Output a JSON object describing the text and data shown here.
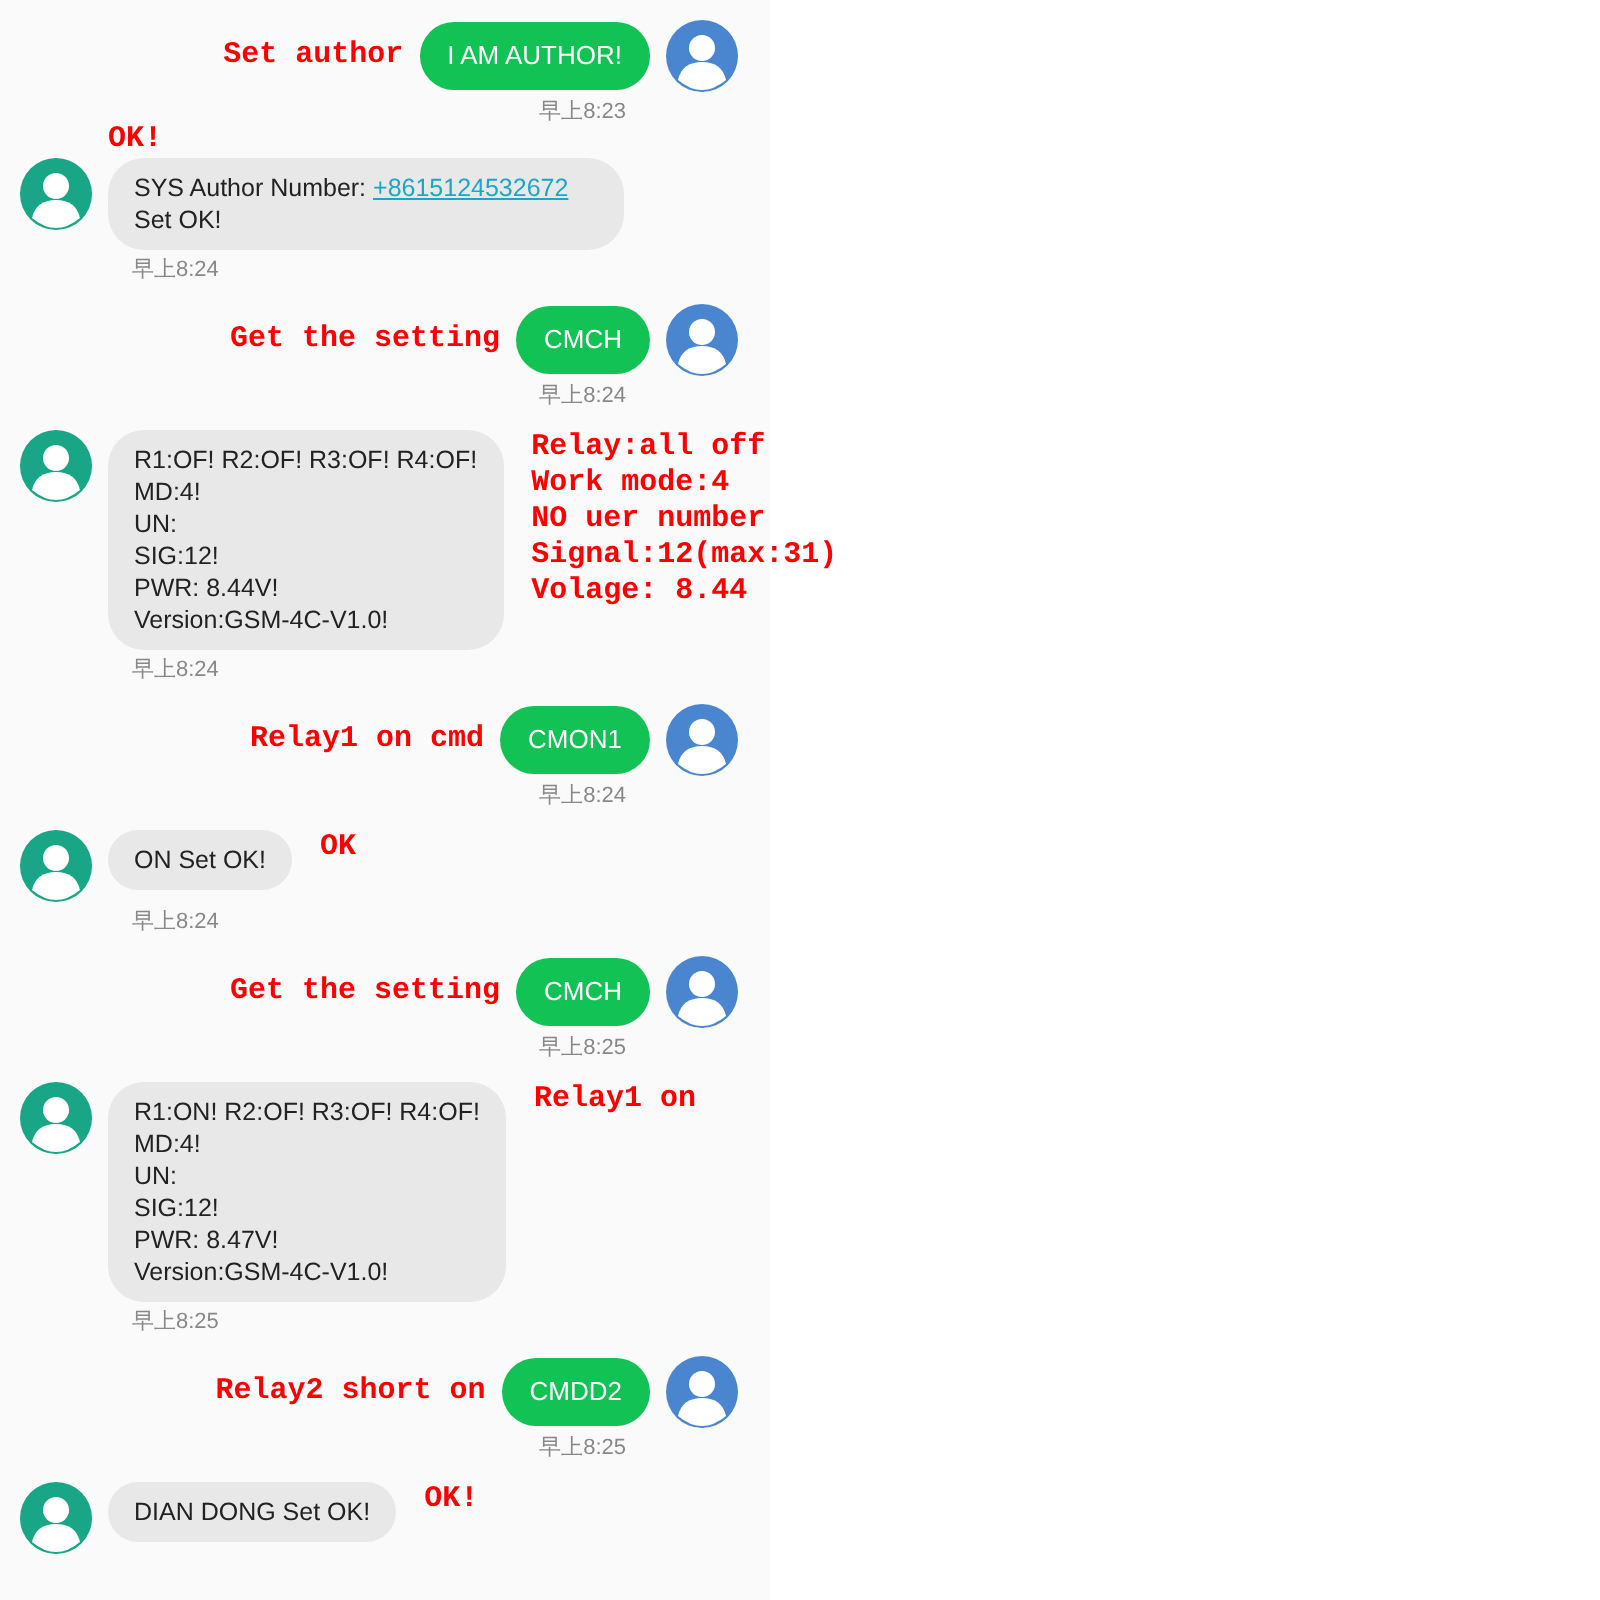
{
  "messages": [
    {
      "kind": "sent",
      "lines": [
        "I AM AUTHOR!"
      ],
      "time": "早上8:23",
      "notes": [
        "Set author"
      ]
    },
    {
      "kind": "received_link",
      "before": "SYS Author Number: ",
      "link": "+8615124532672",
      "after": " Set OK!",
      "time": "早上8:24",
      "notes_above": [
        "OK!"
      ]
    },
    {
      "kind": "sent",
      "lines": [
        "CMCH"
      ],
      "time": "早上8:24",
      "notes": [
        "Get the setting"
      ]
    },
    {
      "kind": "received",
      "lines": [
        "R1:OF! R2:OF! R3:OF! R4:OF!",
        "MD:4!",
        "UN:",
        "SIG:12!",
        "PWR: 8.44V!",
        "Version:GSM-4C-V1.0!"
      ],
      "time": "早上8:24",
      "notes": [
        "Relay:all off",
        "Work mode:4",
        "NO uer number",
        "Signal:12(max:31)",
        "Volage: 8.44"
      ]
    },
    {
      "kind": "sent",
      "lines": [
        "CMON1"
      ],
      "time": "早上8:24",
      "notes": [
        "Relay1 on cmd"
      ]
    },
    {
      "kind": "received",
      "lines": [
        "ON Set OK!"
      ],
      "time": "早上8:24",
      "notes": [
        "OK"
      ]
    },
    {
      "kind": "sent",
      "lines": [
        "CMCH"
      ],
      "time": "早上8:25",
      "notes": [
        "Get the setting"
      ]
    },
    {
      "kind": "received",
      "lines": [
        "R1:ON! R2:OF! R3:OF! R4:OF!",
        "MD:4!",
        "UN:",
        "SIG:12!",
        "PWR: 8.47V!",
        "Version:GSM-4C-V1.0!"
      ],
      "time": "早上8:25",
      "notes": [
        "Relay1 on"
      ]
    },
    {
      "kind": "sent",
      "lines": [
        "CMDD2"
      ],
      "time": "早上8:25",
      "notes": [
        "Relay2 short on"
      ]
    },
    {
      "kind": "received",
      "lines": [
        "DIAN DONG Set OK!"
      ],
      "notes": [
        "OK!"
      ]
    }
  ]
}
